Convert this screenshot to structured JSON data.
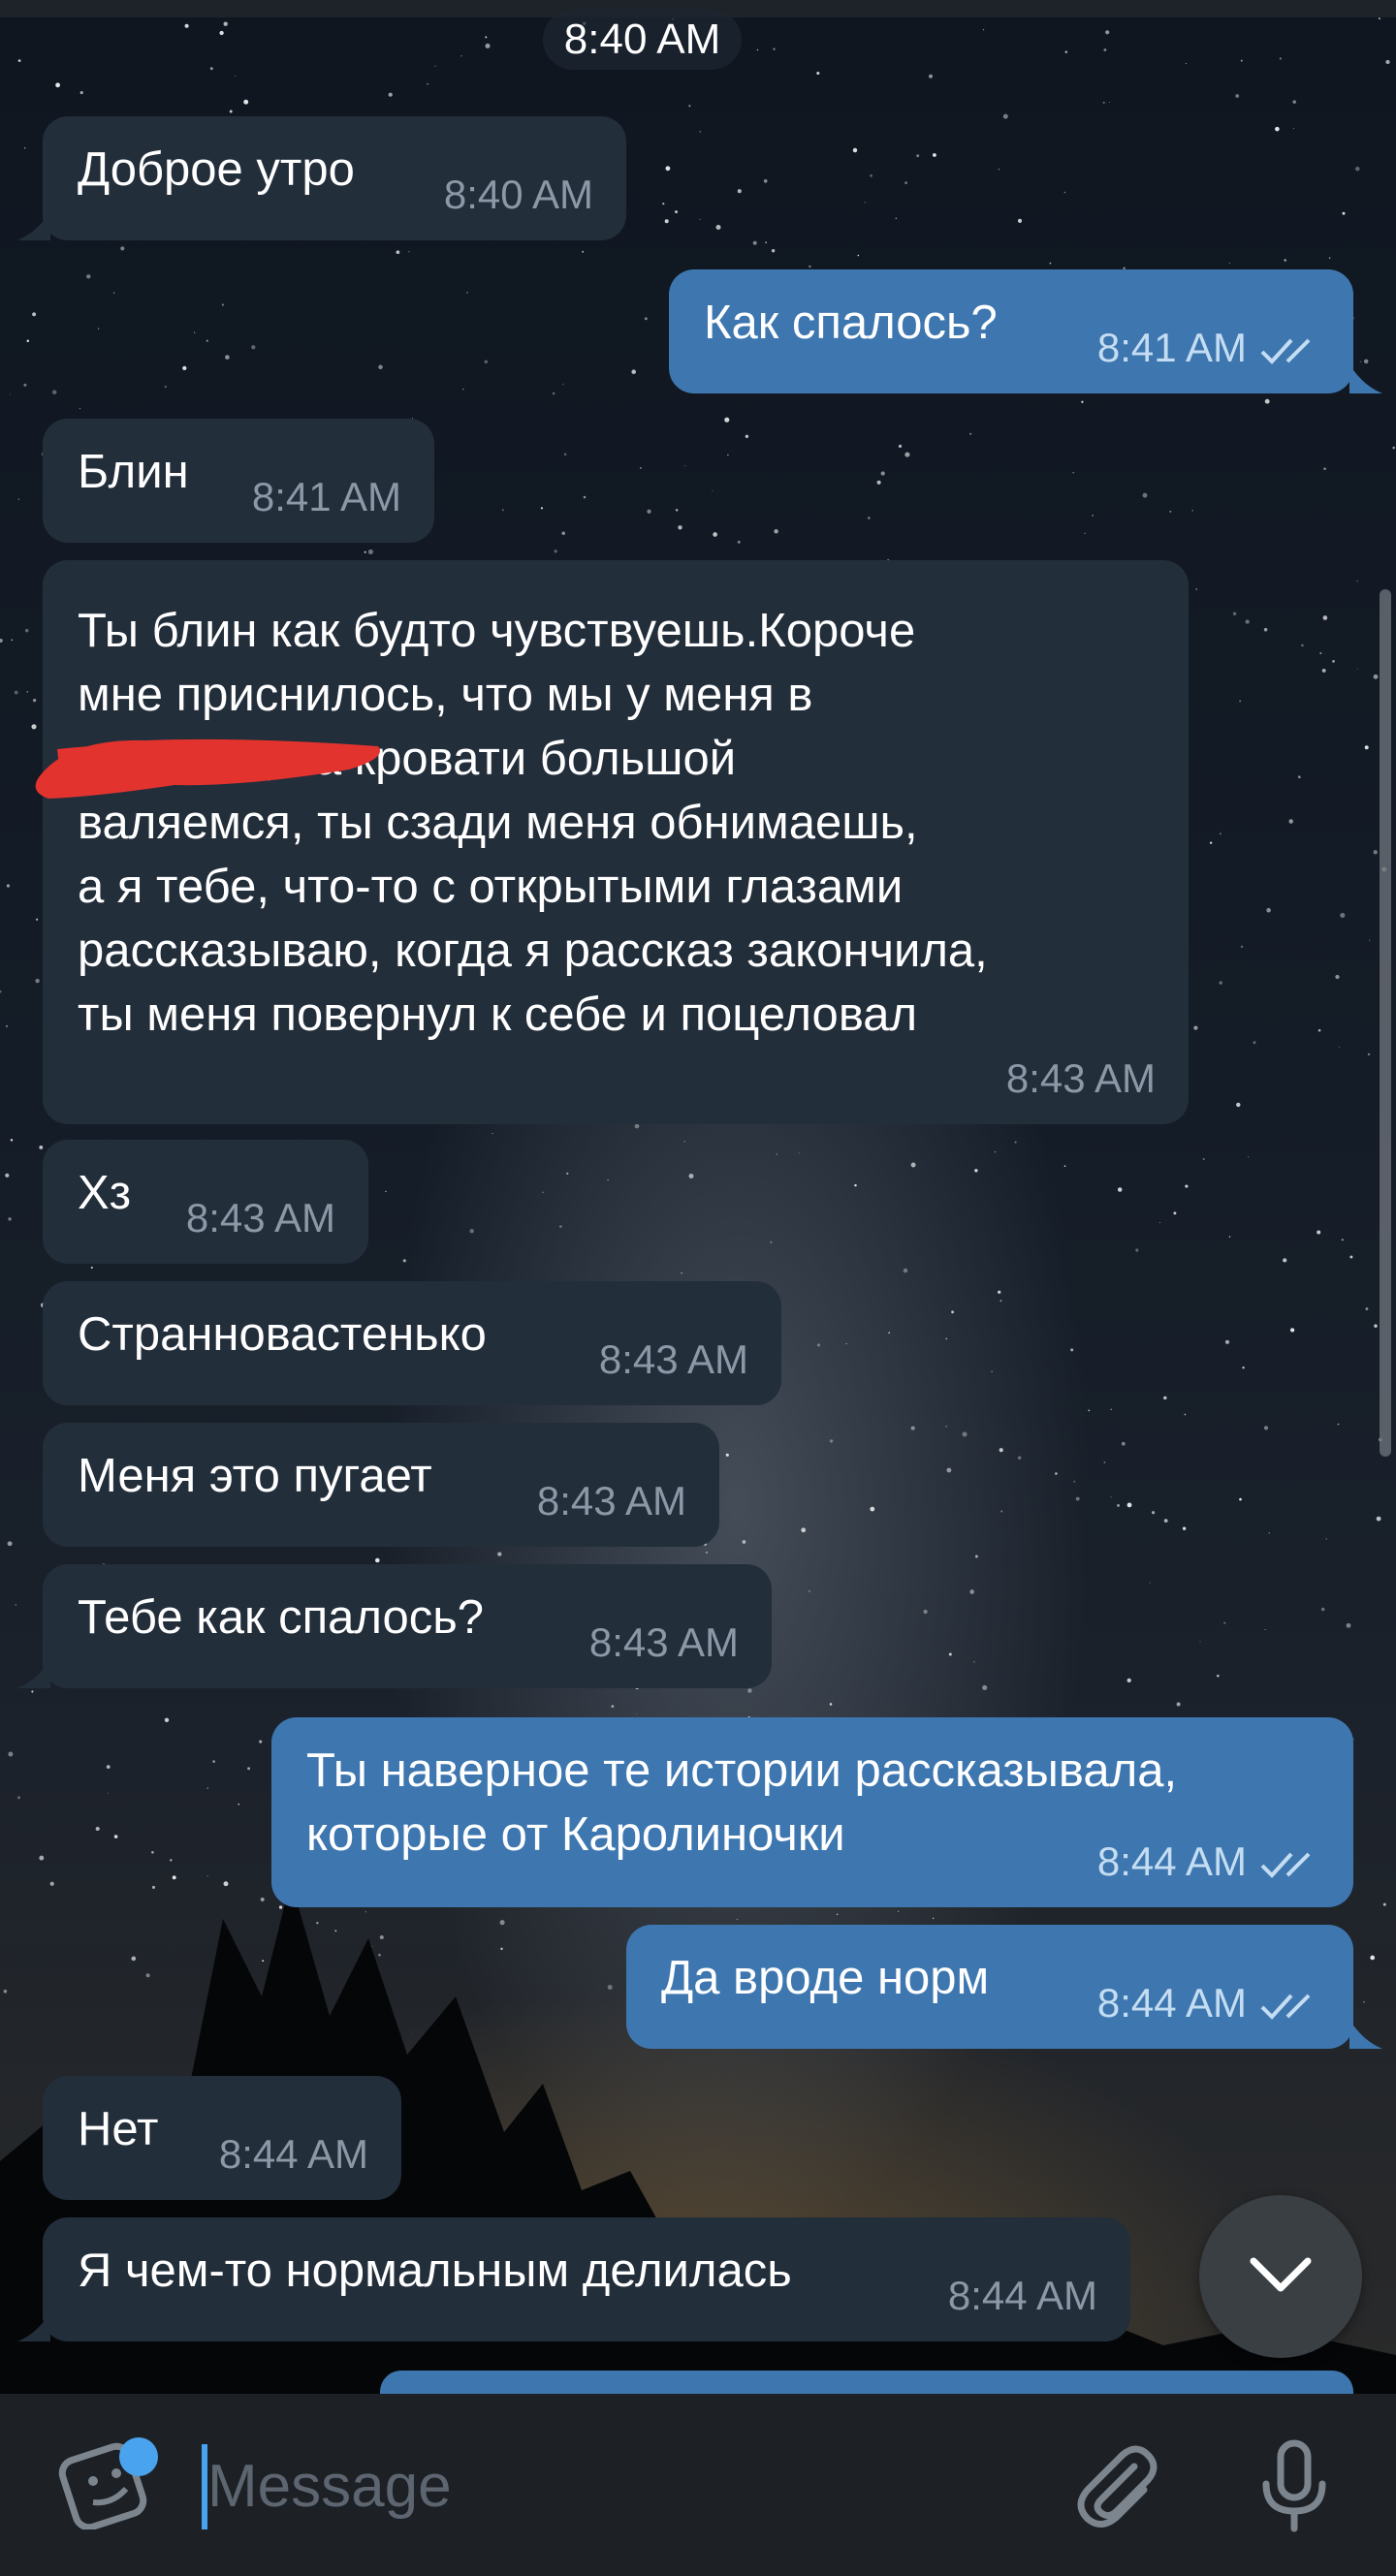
{
  "date_header": "8:40 AM",
  "messages": [
    {
      "dir": "in",
      "text": "Доброе утро",
      "time": "8:40 AM"
    },
    {
      "dir": "out",
      "text": "Как спалось?",
      "time": "8:41 AM"
    },
    {
      "dir": "in",
      "text": "Блин",
      "time": "8:41 AM"
    },
    {
      "dir": "in",
      "text": "Ты блин как будто чувствуешь.Короче\nмне приснилось, что мы у меня в\n              , на кровати большой\nваляемся, ты сзади меня обнимаешь,\nа я тебе, что-то с открытыми глазами\nрассказываю, когда я рассказ закончила,\nты меня повернул к себе и поцеловал",
      "time": "8:43 AM"
    },
    {
      "dir": "in",
      "text": "Хз",
      "time": "8:43 AM"
    },
    {
      "dir": "in",
      "text": "Странновастенько",
      "time": "8:43 AM"
    },
    {
      "dir": "in",
      "text": "Меня это пугает",
      "time": "8:43 AM"
    },
    {
      "dir": "in",
      "text": "Тебе как спалось?",
      "time": "8:43 AM"
    },
    {
      "dir": "out",
      "text": "Ты наверное те истории рассказывала,\nкоторые от Каролиночки",
      "time": "8:44 AM"
    },
    {
      "dir": "out",
      "text": "Да вроде норм",
      "time": "8:44 AM"
    },
    {
      "dir": "in",
      "text": "Нет",
      "time": "8:44 AM"
    },
    {
      "dir": "in",
      "text": "Я чем-то нормальным делилась",
      "time": "8:44 AM"
    }
  ],
  "composer": {
    "placeholder": "Message"
  },
  "icons": {
    "emoji": "sticker-emoji-icon",
    "attach": "paperclip-icon",
    "mic": "microphone-icon",
    "scroll": "chevron-down-icon",
    "read": "double-check-icon"
  },
  "colors": {
    "incoming": "#232e3b",
    "outgoing": "#3e77b0",
    "accent": "#4aa3ee"
  }
}
